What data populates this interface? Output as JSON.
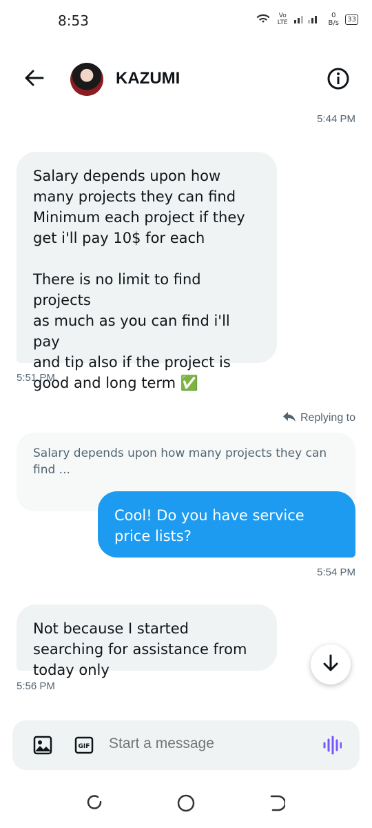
{
  "status_bar": {
    "time": "8:53",
    "network": "Vo LTE",
    "speed": "0 B/s",
    "battery": "33"
  },
  "header": {
    "title": "KAZUMI"
  },
  "messages": [
    {
      "timestamp": "5:44 PM"
    },
    {
      "text_lines": [
        "Salary depends upon how",
        "many projects they can find",
        "Minimum each project if they",
        "get i'll pay 10$ for each",
        "",
        "There is no limit to find projects",
        "as much as you can find i'll pay",
        "and tip also if the project is",
        "good and long term ✅"
      ],
      "timestamp": "5:51 PM"
    }
  ],
  "reply": {
    "label": "Replying to",
    "preview": "Salary depends upon how many projects they can find ...",
    "text": "Cool! Do you have service price lists?",
    "timestamp": "5:54 PM"
  },
  "last_message": {
    "text": "Not because I started searching for assistance from today only",
    "timestamp": "5:56 PM"
  },
  "composer": {
    "placeholder": "Start a message"
  },
  "colors": {
    "accent": "#1d9bf0",
    "incoming_bg": "#eff3f4",
    "voice_icon": "#7856ff"
  }
}
